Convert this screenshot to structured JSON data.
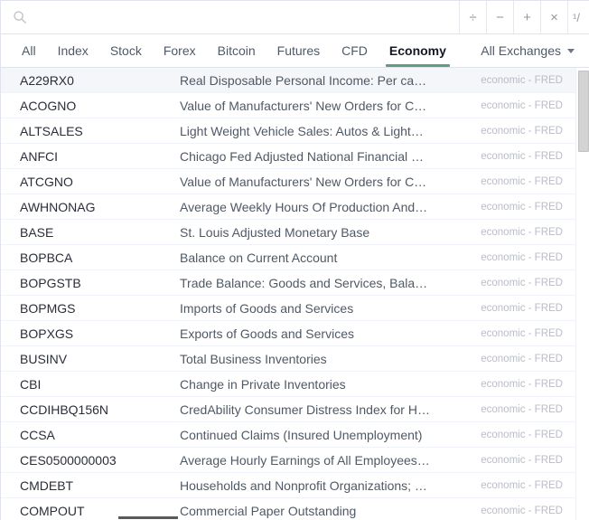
{
  "toolbar": {
    "search_icon": "search-icon",
    "search_value": "",
    "search_placeholder": "",
    "operators": [
      {
        "name": "divide-button",
        "label": "÷"
      },
      {
        "name": "minus-button",
        "label": "−"
      },
      {
        "name": "plus-button",
        "label": "+"
      },
      {
        "name": "multiply-button",
        "label": "×"
      },
      {
        "name": "reciprocal-button",
        "label": "¹/"
      }
    ]
  },
  "tabs": {
    "items": [
      {
        "label": "All",
        "active": false
      },
      {
        "label": "Index",
        "active": false
      },
      {
        "label": "Stock",
        "active": false
      },
      {
        "label": "Forex",
        "active": false
      },
      {
        "label": "Bitcoin",
        "active": false
      },
      {
        "label": "Futures",
        "active": false
      },
      {
        "label": "CFD",
        "active": false
      },
      {
        "label": "Economy",
        "active": true
      }
    ],
    "active_label": "Economy",
    "exchange_filter": "All Exchanges",
    "accent_color": "#5c9e7e"
  },
  "list": {
    "selected_index": 0,
    "rows": [
      {
        "symbol": "A229RX0",
        "description": "Real Disposable Personal Income: Per ca…",
        "source": "economic - FRED"
      },
      {
        "symbol": "ACOGNO",
        "description": "Value of Manufacturers' New Orders for C…",
        "source": "economic - FRED"
      },
      {
        "symbol": "ALTSALES",
        "description": "Light Weight Vehicle Sales: Autos & Light…",
        "source": "economic - FRED"
      },
      {
        "symbol": "ANFCI",
        "description": "Chicago Fed Adjusted National Financial …",
        "source": "economic - FRED"
      },
      {
        "symbol": "ATCGNO",
        "description": "Value of Manufacturers' New Orders for C…",
        "source": "economic - FRED"
      },
      {
        "symbol": "AWHNONAG",
        "description": "Average Weekly Hours Of Production And…",
        "source": "economic - FRED"
      },
      {
        "symbol": "BASE",
        "description": "St. Louis Adjusted Monetary Base",
        "source": "economic - FRED"
      },
      {
        "symbol": "BOPBCA",
        "description": "Balance on Current Account",
        "source": "economic - FRED"
      },
      {
        "symbol": "BOPGSTB",
        "description": "Trade Balance: Goods and Services, Bala…",
        "source": "economic - FRED"
      },
      {
        "symbol": "BOPMGS",
        "description": "Imports of Goods and Services",
        "source": "economic - FRED"
      },
      {
        "symbol": "BOPXGS",
        "description": "Exports of Goods and Services",
        "source": "economic - FRED"
      },
      {
        "symbol": "BUSINV",
        "description": "Total Business Inventories",
        "source": "economic - FRED"
      },
      {
        "symbol": "CBI",
        "description": "Change in Private Inventories",
        "source": "economic - FRED"
      },
      {
        "symbol": "CCDIHBQ156N",
        "description": "CredAbility Consumer Distress Index for H…",
        "source": "economic - FRED"
      },
      {
        "symbol": "CCSA",
        "description": "Continued Claims (Insured Unemployment)",
        "source": "economic - FRED"
      },
      {
        "symbol": "CES0500000003",
        "description": "Average Hourly Earnings of All Employees…",
        "source": "economic - FRED"
      },
      {
        "symbol": "CMDEBT",
        "description": "Households and Nonprofit Organizations; …",
        "source": "economic - FRED"
      },
      {
        "symbol": "COMPOUT",
        "description": "Commercial Paper Outstanding",
        "source": "economic - FRED"
      }
    ]
  },
  "scrollbars": {
    "vertical_name": "vertical-scrollbar",
    "horizontal_name": "horizontal-scrollbar"
  }
}
